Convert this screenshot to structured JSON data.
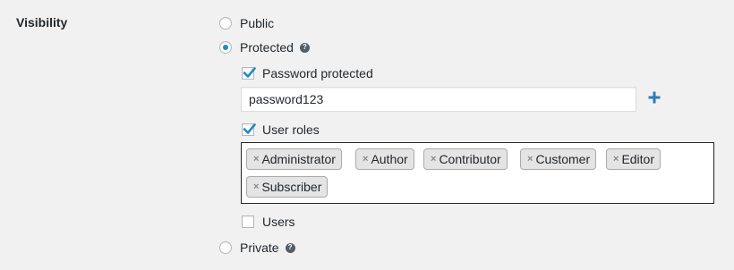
{
  "field": {
    "label": "Visibility"
  },
  "options": {
    "public": {
      "label": "Public",
      "checked": false
    },
    "protected": {
      "label": "Protected",
      "checked": true
    },
    "private": {
      "label": "Private",
      "checked": false
    }
  },
  "protected_settings": {
    "password_protected": {
      "label": "Password protected",
      "checked": true
    },
    "password": {
      "value": "password123"
    },
    "user_roles": {
      "label": "User roles",
      "checked": true
    },
    "roles": [
      "Administrator",
      "Author",
      "Contributor",
      "Customer",
      "Editor",
      "Subscriber"
    ],
    "users": {
      "label": "Users",
      "checked": false
    }
  },
  "icons": {
    "help": "question-circle-icon",
    "add": "plus-icon",
    "remove_tag": "close-icon",
    "checkmark": "checkmark-icon"
  },
  "colors": {
    "accent": "#1e8cbe",
    "checkmark": "#1e8cbe",
    "background": "#f1f1f1",
    "text": "#23282d"
  }
}
